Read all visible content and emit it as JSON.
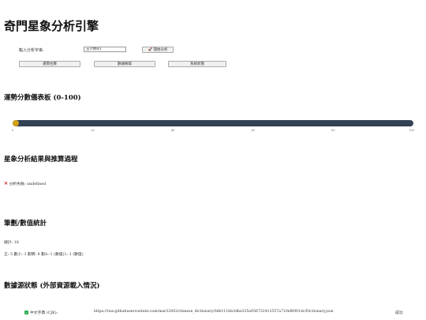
{
  "app": {
    "title": "奇門星象分析引擎"
  },
  "controls": {
    "input_label": "輸入分析字串:",
    "input_value": "王小明A1",
    "analyze_icon": "rocket-icon",
    "analyze_label": "🚀 開始分析",
    "buttons": [
      "運勢估算",
      "數據摘取",
      "系統狀態"
    ]
  },
  "gauge": {
    "heading": "運勢分數儀表板 (0-100)",
    "value": 0,
    "ticks": [
      "0",
      "20",
      "40",
      "60",
      "80",
      "100"
    ],
    "colors": {
      "track": "#334155",
      "fill": "#d4a017"
    }
  },
  "analysis": {
    "heading": "星象分析結果與推算過程",
    "error_icon": "cross-mark-icon",
    "error_text": "分析失敗: undefined"
  },
  "stats": {
    "heading": "筆劃/數值統計",
    "total": "總計: 18",
    "detail": "王: 5 劃小: 3 劃明: 8 劃A: 1 (數值)1: 1 (數值)"
  },
  "sources": {
    "heading": "數據源狀態 (外部資源載入情況)",
    "items": [
      {
        "icon": "check-mark-icon",
        "name": "中文字典 (CJK):",
        "url": "https://raw.githubusercontent.com/mar32002/chinese_dictionary/0db111bb3dbe335a956732413557a710ef6901dc/Dictionary.json",
        "status": "成功"
      }
    ]
  }
}
